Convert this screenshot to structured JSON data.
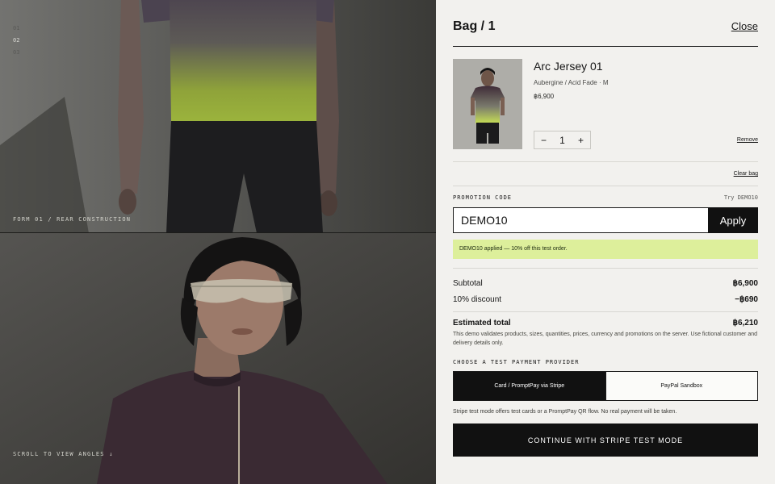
{
  "gallery": {
    "indices": [
      "01",
      "02",
      "03"
    ],
    "active_index": "02",
    "caption_top": "FORM 01 / REAR CONSTRUCTION",
    "caption_bottom": "SCROLL TO VIEW ANGLES ↓",
    "jersey_accent": "#a9c93a",
    "jersey_main": "#3c2a34"
  },
  "bag": {
    "title": "Bag / 1",
    "close_label": "Close",
    "item": {
      "name": "Arc Jersey 01",
      "variant": "Aubergine / Acid Fade · M",
      "price": "฿6,900",
      "quantity": "1",
      "decrement": "−",
      "increment": "+",
      "remove_label": "Remove"
    },
    "clear_label": "Clear bag",
    "promo": {
      "label": "PROMOTION CODE",
      "hint": "Try DEMO10",
      "value": "DEMO10",
      "apply_label": "Apply",
      "success": "DEMO10 applied — 10% off this test order."
    },
    "summary": {
      "subtotal_label": "Subtotal",
      "subtotal_value": "฿6,900",
      "discount_label": "10% discount",
      "discount_value": "−฿690",
      "total_label": "Estimated total",
      "total_value": "฿6,210",
      "disclaimer": "This demo validates products, sizes, quantities, prices, currency and promotions on the server. Use fictional customer and delivery details only."
    },
    "payment": {
      "label": "CHOOSE A TEST PAYMENT PROVIDER",
      "options": [
        "Card / PromptPay via Stripe",
        "PayPal Sandbox"
      ],
      "selected": "Card / PromptPay via Stripe",
      "note": "Stripe test mode offers test cards or a PromptPay QR flow. No real payment will be taken.",
      "cta": "CONTINUE WITH STRIPE TEST MODE"
    }
  }
}
